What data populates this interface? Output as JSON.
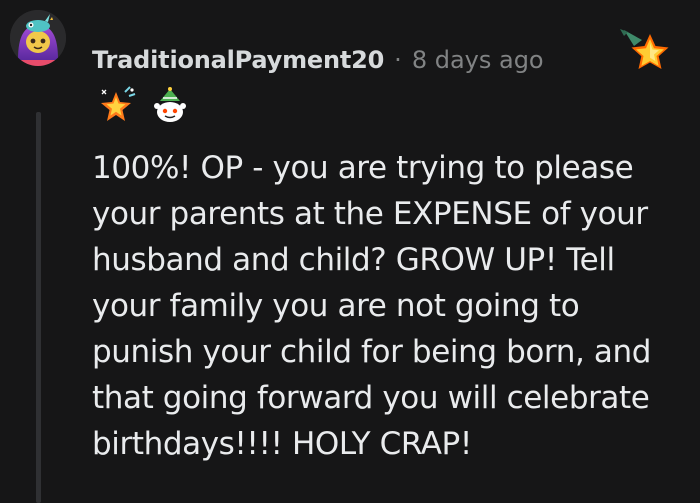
{
  "comment": {
    "username": "TraditionalPayment20",
    "separator": "·",
    "timestamp": "8 days ago",
    "body": "100%! OP - you are trying to please your parents at the EXPENSE of your husband and child? GROW UP! Tell your family you are not going to punish your child for being born, and that going forward you will celebrate birthdays!!!! HOLY CRAP!"
  },
  "icons": {
    "avatar": "avatar-icon",
    "award": "star-award-icon",
    "flair_1": "sparkle-star-icon",
    "flair_2": "party-snoo-icon"
  },
  "colors": {
    "background": "#161617",
    "username": "#d7dadc",
    "meta": "#818384",
    "body_text": "#e9ebed",
    "thread_line": "#2f3033",
    "award_yellow": "#f6c33b",
    "award_orange": "#ff6a00"
  }
}
